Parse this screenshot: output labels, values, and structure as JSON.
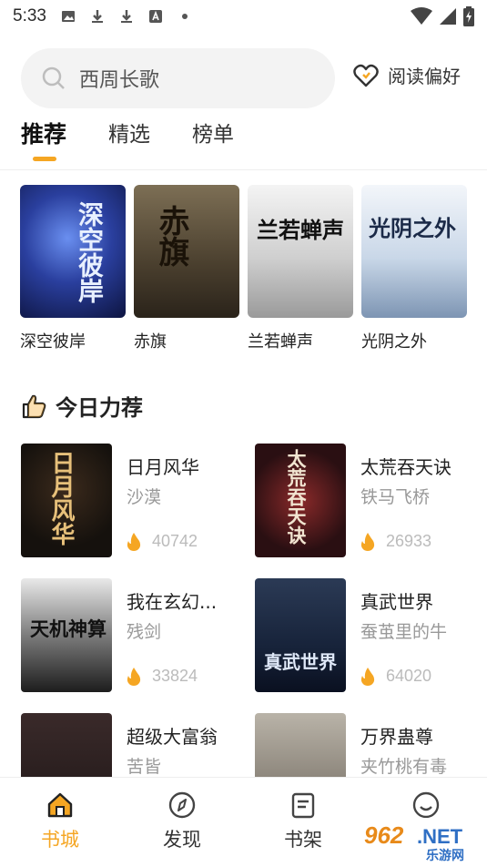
{
  "status_bar": {
    "time": "5:33",
    "icons": [
      "image-icon",
      "download-icon",
      "download-icon",
      "font-icon",
      "dot-icon"
    ],
    "right_icons": [
      "wifi-icon",
      "signal-icon",
      "battery-icon"
    ]
  },
  "search": {
    "placeholder": "西周长歌"
  },
  "preference": {
    "label": "阅读偏好"
  },
  "tabs": [
    {
      "label": "推荐",
      "active": true
    },
    {
      "label": "精选",
      "active": false
    },
    {
      "label": "榜单",
      "active": false
    }
  ],
  "recommended": [
    {
      "title": "深空彼岸",
      "cover_text": "深空彼岸"
    },
    {
      "title": "赤旗",
      "cover_text": "赤旗"
    },
    {
      "title": "兰若蝉声",
      "cover_text": "兰若蝉声"
    },
    {
      "title": "光阴之外",
      "cover_text": "光阴之外"
    }
  ],
  "section": {
    "title": "今日力荐"
  },
  "books": [
    {
      "title": "日月风华",
      "author": "沙漠",
      "heat": "40742",
      "cover_text": "日月风华"
    },
    {
      "title": "太荒吞天诀",
      "author": "铁马飞桥",
      "heat": "26933",
      "cover_text": "太荒吞天诀"
    },
    {
      "title": "我在玄幻...",
      "author": "残剑",
      "heat": "33824",
      "cover_text": "天机神算"
    },
    {
      "title": "真武世界",
      "author": "蚕茧里的牛",
      "heat": "64020",
      "cover_text": "真武世界"
    },
    {
      "title": "超级大富翁",
      "author": "苦皆",
      "heat": "",
      "cover_text": ""
    },
    {
      "title": "万界蛊尊",
      "author": "夹竹桃有毒",
      "heat": "",
      "cover_text": ""
    }
  ],
  "bottom_nav": [
    {
      "label": "书城",
      "icon": "home-icon",
      "active": true
    },
    {
      "label": "发现",
      "icon": "compass-icon",
      "active": false
    },
    {
      "label": "书架",
      "icon": "bookshelf-icon",
      "active": false
    },
    {
      "label": "",
      "icon": "profile-icon",
      "active": false
    }
  ],
  "watermark": {
    "number": "962",
    "suffix": ".NET",
    "site": "乐游网"
  },
  "colors": {
    "accent": "#f5a623",
    "heat": "#f5a623"
  }
}
